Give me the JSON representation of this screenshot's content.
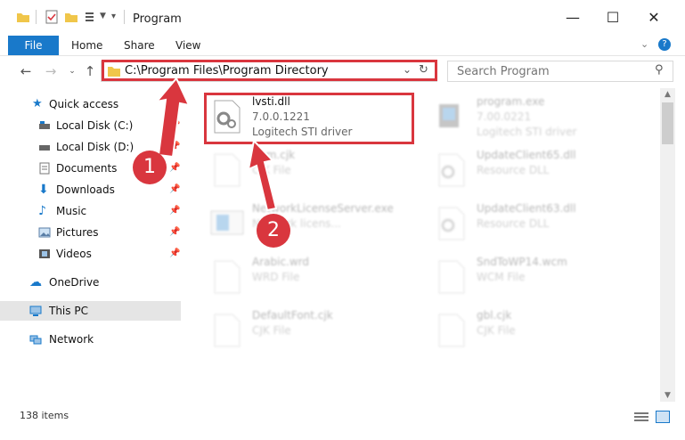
{
  "window": {
    "title": "Program"
  },
  "ribbon": {
    "tabs": [
      "File",
      "Home",
      "Share",
      "View"
    ]
  },
  "address": {
    "path": "C:\\Program Files\\Program Directory"
  },
  "search": {
    "placeholder": "Search Program"
  },
  "sidebar": {
    "items": [
      {
        "label": "Quick access",
        "icon": "star-icon"
      },
      {
        "label": "Local Disk (C:)",
        "icon": "drive-icon"
      },
      {
        "label": "Local Disk (D:)",
        "icon": "drive-icon"
      },
      {
        "label": "Documents",
        "icon": "documents-icon"
      },
      {
        "label": "Downloads",
        "icon": "download-icon"
      },
      {
        "label": "Music",
        "icon": "music-icon"
      },
      {
        "label": "Pictures",
        "icon": "pictures-icon"
      },
      {
        "label": "Videos",
        "icon": "videos-icon"
      },
      {
        "label": "OneDrive",
        "icon": "cloud-icon"
      },
      {
        "label": "This PC",
        "icon": "computer-icon"
      },
      {
        "label": "Network",
        "icon": "network-icon"
      }
    ]
  },
  "files": [
    {
      "name": "lvsti.dll",
      "line2": "7.0.0.1221",
      "line3": "Logitech STI driver"
    },
    {
      "name": "program.exe",
      "line2": "7.00.0221",
      "line3": "Logitech STI driver"
    },
    {
      "name": "Com.cjk",
      "line2": "CJK File",
      "line3": ""
    },
    {
      "name": "UpdateClient65.dll",
      "line2": "Resource DLL",
      "line3": ""
    },
    {
      "name": "NetworkLicenseServer.exe",
      "line2": "Network licens...",
      "line3": ""
    },
    {
      "name": "UpdateClient63.dll",
      "line2": "Resource DLL",
      "line3": ""
    },
    {
      "name": "Arabic.wrd",
      "line2": "WRD File",
      "line3": ""
    },
    {
      "name": "SndToWP14.wcm",
      "line2": "WCM File",
      "line3": ""
    },
    {
      "name": "DefaultFont.cjk",
      "line2": "CJK File",
      "line3": ""
    },
    {
      "name": "gbl.cjk",
      "line2": "CJK File",
      "line3": ""
    }
  ],
  "status": {
    "item_count": "138 items"
  },
  "annotations": {
    "step1": "1",
    "step2": "2"
  },
  "colors": {
    "accent": "#1979ca",
    "highlight": "#d9363e"
  }
}
